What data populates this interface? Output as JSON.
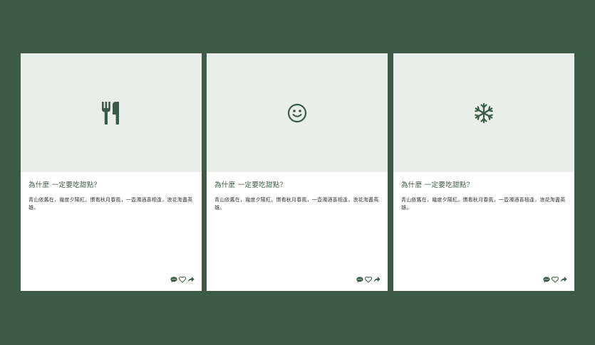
{
  "cards": [
    {
      "icon": "fork-knife-icon",
      "title": "為什麼 一定要吃甜點？",
      "text": "青山依舊在，幾度夕陽紅。慣看秋月春風，一壺濁酒喜相逢，浪花淘盡英雄。"
    },
    {
      "icon": "smiley-icon",
      "title": "為什麼 一定要吃甜點？",
      "text": "青山依舊在，幾度夕陽紅。慣看秋月春風，一壺濁酒喜相逢，浪花淘盡英雄。"
    },
    {
      "icon": "snowflake-icon",
      "title": "為什麼 一定要吃甜點？",
      "text": "青山依舊在，幾度夕陽紅。慣看秋月春風，一壺濁酒喜相逢，浪花淘盡英雄。"
    }
  ],
  "actions": [
    "comment-icon",
    "heart-icon",
    "share-icon"
  ],
  "colors": {
    "background": "#3c5a45",
    "icon": "#3c5a45",
    "media": "#e8eee9",
    "card": "#ffffff"
  }
}
